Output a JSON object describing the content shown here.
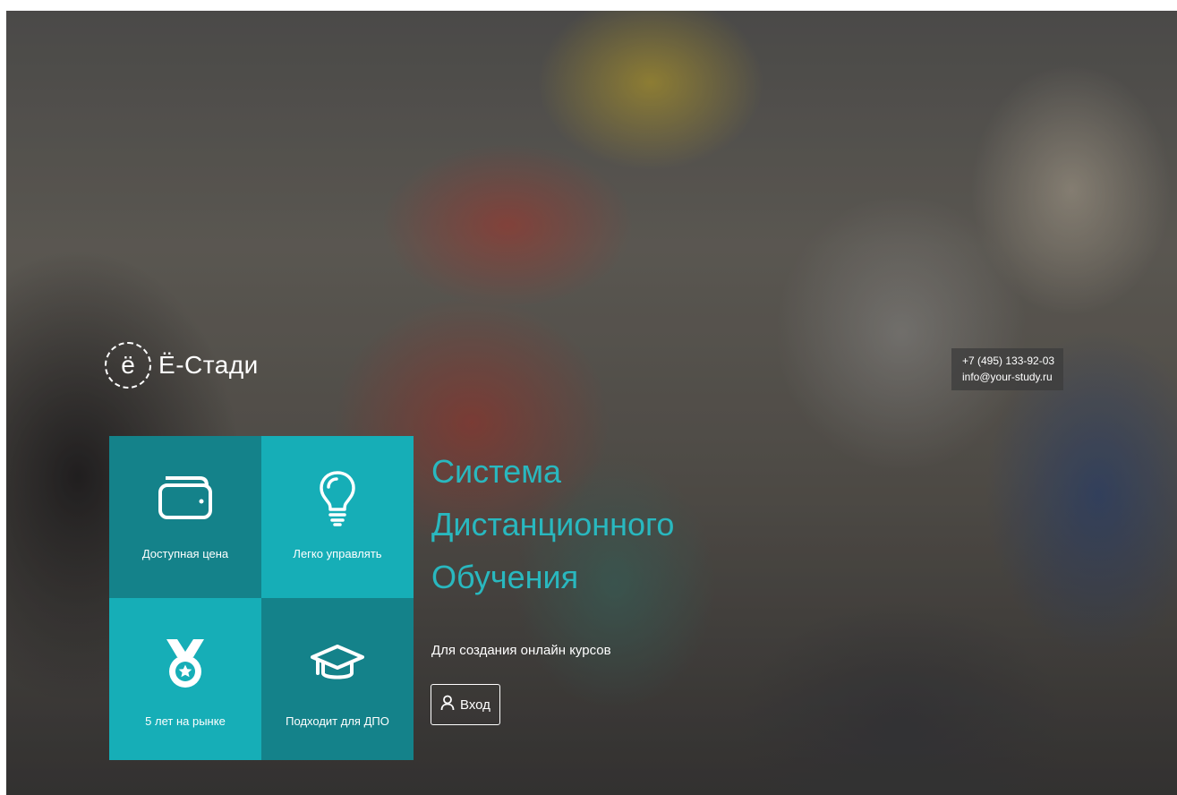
{
  "brand": {
    "logo_letter": "ё",
    "name": "Ё-Стади"
  },
  "contacts": {
    "phone": "+7 (495) 133-92-03",
    "email": "info@your-study.ru"
  },
  "features": [
    {
      "label": "Доступная цена",
      "icon": "wallet-icon"
    },
    {
      "label": "Легко управлять",
      "icon": "lightbulb-icon"
    },
    {
      "label": "5 лет на рынке",
      "icon": "medal-icon"
    },
    {
      "label": "Подходит для ДПО",
      "icon": "graduation-cap-icon"
    }
  ],
  "hero": {
    "title_lines": [
      "Система",
      "Дистанционного",
      "Обучения"
    ],
    "subtitle": "Для создания онлайн курсов",
    "login_label": "Вход",
    "login_icon": "user-icon"
  },
  "colors": {
    "tile_dark": "#14828a",
    "tile_light": "#16aeb7",
    "title_accent": "#29b8bf"
  }
}
